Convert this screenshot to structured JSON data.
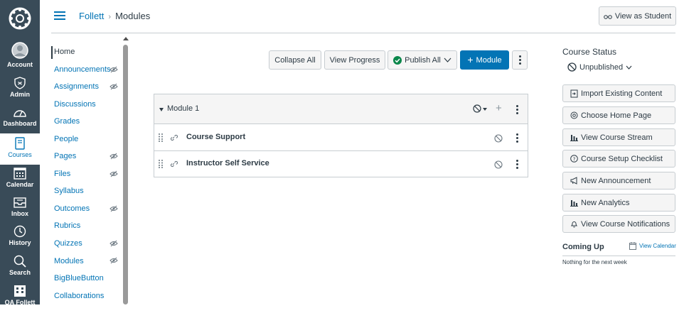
{
  "global_nav": {
    "items": [
      {
        "label": "Account",
        "icon": "user-avatar-icon"
      },
      {
        "label": "Admin",
        "icon": "shield-icon"
      },
      {
        "label": "Dashboard",
        "icon": "speedometer-icon"
      },
      {
        "label": "Courses",
        "icon": "book-icon",
        "active": true
      },
      {
        "label": "Calendar",
        "icon": "calendar-icon"
      },
      {
        "label": "Inbox",
        "icon": "inbox-icon"
      },
      {
        "label": "History",
        "icon": "clock-icon"
      },
      {
        "label": "Search",
        "icon": "search-icon"
      },
      {
        "label": "QA Follett",
        "icon": "building-icon"
      }
    ]
  },
  "breadcrumb": {
    "course": "Follett",
    "page": "Modules"
  },
  "header": {
    "view_as_student": "View as Student"
  },
  "course_nav": {
    "items": [
      {
        "label": "Home",
        "active": true,
        "hidden": false
      },
      {
        "label": "Announcements",
        "hidden": true
      },
      {
        "label": "Assignments",
        "hidden": true
      },
      {
        "label": "Discussions",
        "hidden": false
      },
      {
        "label": "Grades",
        "hidden": false
      },
      {
        "label": "People",
        "hidden": false
      },
      {
        "label": "Pages",
        "hidden": true
      },
      {
        "label": "Files",
        "hidden": true
      },
      {
        "label": "Syllabus",
        "hidden": false
      },
      {
        "label": "Outcomes",
        "hidden": true
      },
      {
        "label": "Rubrics",
        "hidden": false
      },
      {
        "label": "Quizzes",
        "hidden": true
      },
      {
        "label": "Modules",
        "hidden": true
      },
      {
        "label": "BigBlueButton",
        "hidden": false
      },
      {
        "label": "Collaborations",
        "hidden": false
      }
    ]
  },
  "toolbar": {
    "collapse_all": "Collapse All",
    "view_progress": "View Progress",
    "publish_all": "Publish All",
    "add_module": "Module"
  },
  "module": {
    "title": "Module 1",
    "items": [
      {
        "title": "Course Support",
        "type": "external-link"
      },
      {
        "title": "Instructor Self Service",
        "type": "external-link"
      }
    ]
  },
  "sidebar": {
    "course_status_title": "Course Status",
    "status_value": "Unpublished",
    "buttons": [
      {
        "label": "Import Existing Content",
        "icon": "import-icon"
      },
      {
        "label": "Choose Home Page",
        "icon": "target-icon"
      },
      {
        "label": "View Course Stream",
        "icon": "bar-chart-icon"
      },
      {
        "label": "Course Setup Checklist",
        "icon": "question-icon"
      },
      {
        "label": "New Announcement",
        "icon": "megaphone-icon"
      },
      {
        "label": "New Analytics",
        "icon": "bar-chart-icon"
      },
      {
        "label": "View Course Notifications",
        "icon": "bell-icon"
      }
    ],
    "coming_up": "Coming Up",
    "view_calendar": "View Calendar",
    "nothing": "Nothing for the next week"
  },
  "colors": {
    "nav_bg": "#394b58",
    "link": "#0374b5",
    "publish_green": "#0b874b",
    "button_blue": "#0374b5"
  }
}
